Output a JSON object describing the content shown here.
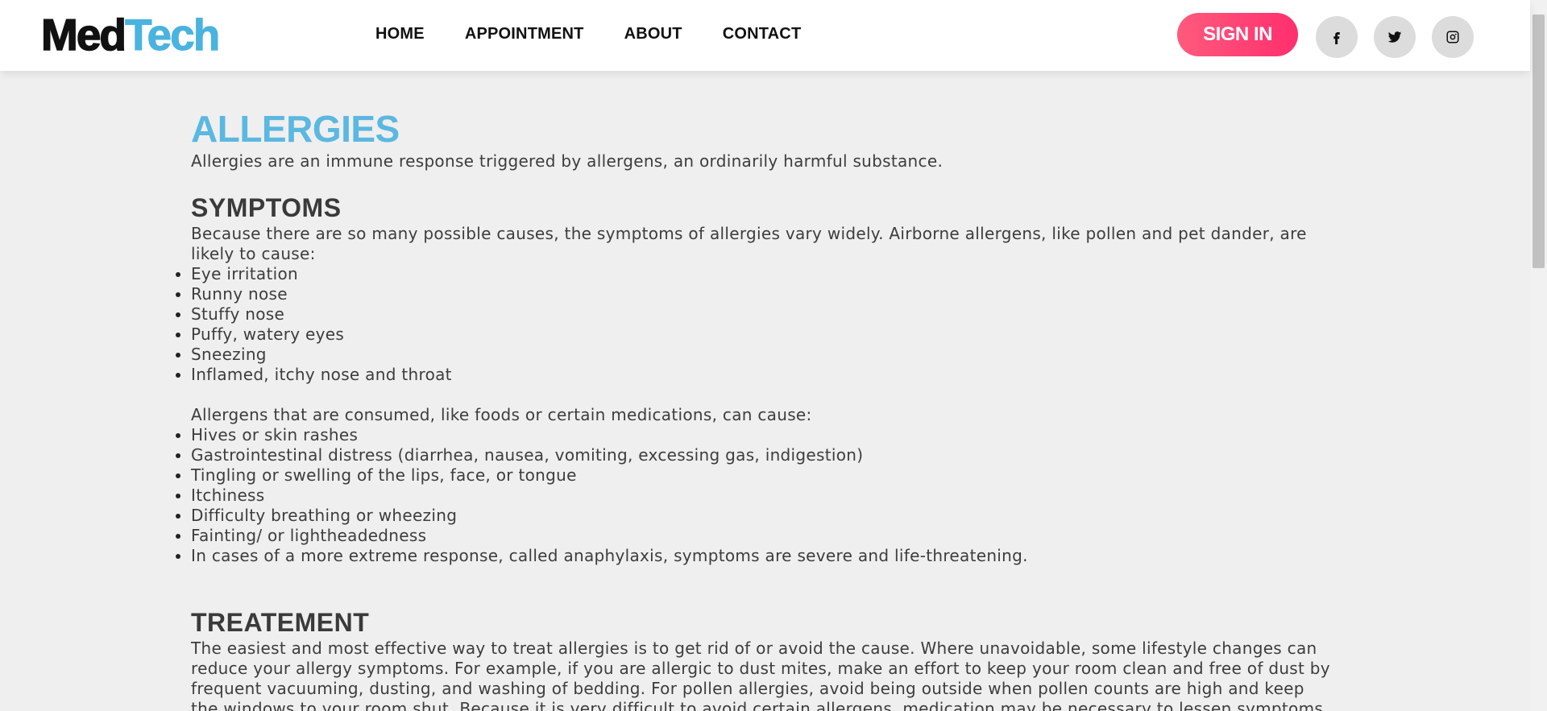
{
  "brand": {
    "part1": "Med",
    "part2": "Tech"
  },
  "nav": {
    "items": [
      {
        "label": "HOME"
      },
      {
        "label": "APPOINTMENT"
      },
      {
        "label": "ABOUT"
      },
      {
        "label": "CONTACT"
      }
    ]
  },
  "header": {
    "signin_label": "SIGN IN"
  },
  "social": [
    {
      "icon": "facebook-icon"
    },
    {
      "icon": "twitter-icon"
    },
    {
      "icon": "instagram-icon"
    }
  ],
  "article": {
    "title": "ALLERGIES",
    "intro": "Allergies are an immune response triggered by allergens, an ordinarily harmful substance.",
    "symptoms": {
      "heading": "SYMPTOMS",
      "airborne_intro": "Because there are so many possible causes, the symptoms of allergies vary widely. Airborne allergens, like pollen and pet dander, are likely to cause:",
      "airborne_list": [
        "Eye irritation",
        "Runny nose",
        "Stuffy nose",
        "Puffy, watery eyes",
        "Sneezing",
        "Inflamed, itchy nose and throat"
      ],
      "consumed_intro": "Allergens that are consumed, like foods or certain medications, can cause:",
      "consumed_list": [
        "Hives or skin rashes",
        "Gastrointestinal distress (diarrhea, nausea, vomiting, excessing gas, indigestion)",
        "Tingling or swelling of the lips, face, or tongue",
        "Itchiness",
        "Difficulty breathing or wheezing",
        "Fainting/ or lightheadedness",
        "In cases of a more extreme response, called anaphylaxis, symptoms are severe and life-threatening."
      ]
    },
    "treatment": {
      "heading": "TREATEMENT",
      "text": "The easiest and most effective way to treat allergies is to get rid of or avoid the cause. Where unavoidable, some lifestyle changes can reduce your allergy symptoms. For example, if you are allergic to dust mites, make an effort to keep your room clean and free of dust by frequent vacuuming, dusting, and washing of bedding. For pollen allergies, avoid being outside when pollen counts are high and keep the windows to your room shut. Because it is very difficult to avoid certain allergens, medication may be necessary to lessen symptoms"
    }
  },
  "colors": {
    "accent": "#5bb8e0",
    "signin_gradient_start": "#ff5a7d",
    "signin_gradient_end": "#ff2f6e",
    "page_bg": "#efefef"
  }
}
